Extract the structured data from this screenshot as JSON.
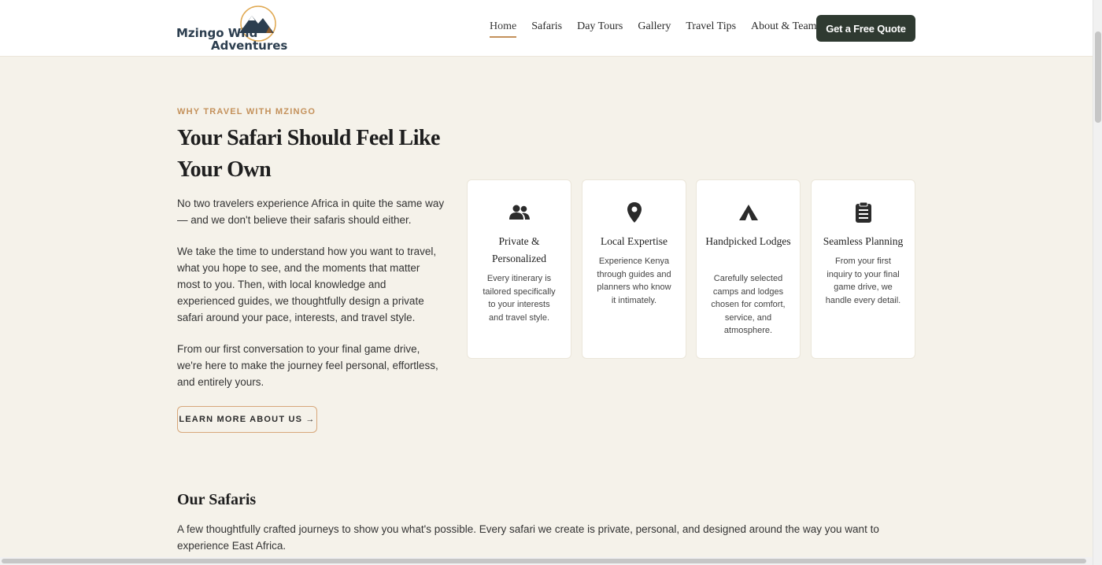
{
  "brand": {
    "line1": "Mzingo Wild",
    "line2": "Adventures"
  },
  "nav": {
    "items": [
      "Home",
      "Safaris",
      "Day Tours",
      "Gallery",
      "Travel Tips",
      "About & Team"
    ],
    "active": "Home",
    "cta": "Get a Free Quote"
  },
  "intro": {
    "eyebrow": "WHY TRAVEL WITH MZINGO",
    "heading": "Your Safari Should Feel Like Your Own",
    "paragraphs": [
      "No two travelers experience Africa in quite the same way — and we don't believe their safaris should either.",
      "We take the time to understand how you want to travel, what you hope to see, and the moments that matter most to you. Then, with local knowledge and experienced guides, we thoughtfully design a private safari around your pace, interests, and travel style.",
      "From our first conversation to your final game drive, we're here to make the journey feel personal, effortless, and entirely yours."
    ],
    "button": "LEARN MORE ABOUT US →"
  },
  "features": [
    {
      "icon": "people-icon",
      "title": "Private & Personalized",
      "desc": "Every itinerary is tailored specifically to your interests and travel style."
    },
    {
      "icon": "map-pin-icon",
      "title": "Local Expertise",
      "desc": "Experience Kenya through guides and planners who know it intimately."
    },
    {
      "icon": "tent-icon",
      "title": "Handpicked Lodges",
      "desc": "Carefully selected camps and lodges chosen for comfort, service, and atmosphere."
    },
    {
      "icon": "clipboard-icon",
      "title": "Seamless Planning",
      "desc": "From your first inquiry to your final game drive, we handle every detail."
    }
  ],
  "safaris": {
    "title": "Our Safaris",
    "desc": "A few thoughtfully crafted journeys to show you what's possible. Every safari we create is private, personal, and designed around the way you want to experience East Africa."
  },
  "colors": {
    "accent": "#c4915b",
    "dark": "#2f3a31",
    "background": "#f5f2ea"
  }
}
